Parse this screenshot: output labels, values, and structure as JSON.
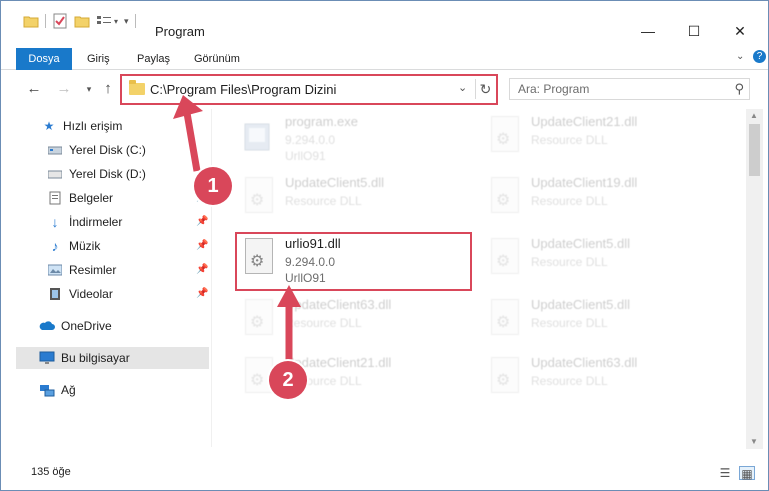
{
  "window": {
    "title": "Program"
  },
  "ribbon": {
    "tabs": [
      {
        "label": "Dosya"
      },
      {
        "label": "Giriş"
      },
      {
        "label": "Paylaş"
      },
      {
        "label": "Görünüm"
      }
    ]
  },
  "address": {
    "path": "C:\\Program Files\\Program Dizini"
  },
  "search": {
    "placeholder": "Ara: Program"
  },
  "sidebar": {
    "items": [
      {
        "label": "Hızlı erişim",
        "icon": "star-icon"
      },
      {
        "label": "Yerel Disk (C:)",
        "icon": "drive-icon"
      },
      {
        "label": "Yerel Disk (D:)",
        "icon": "drive-icon"
      },
      {
        "label": "Belgeler",
        "icon": "documents-icon"
      },
      {
        "label": "İndirmeler",
        "icon": "download-icon"
      },
      {
        "label": "Müzik",
        "icon": "music-icon"
      },
      {
        "label": "Resimler",
        "icon": "pictures-icon"
      },
      {
        "label": "Videolar",
        "icon": "videos-icon"
      },
      {
        "label": "OneDrive",
        "icon": "cloud-icon"
      },
      {
        "label": "Bu bilgisayar",
        "icon": "computer-icon"
      },
      {
        "label": "Ağ",
        "icon": "network-icon"
      }
    ]
  },
  "files": [
    {
      "name": "program.exe",
      "line2": "9.294.0.0",
      "line3": "UrllO91"
    },
    {
      "name": "UpdateClient21.dll",
      "line2": "Resource DLL",
      "line3": ""
    },
    {
      "name": "UpdateClient5.dll",
      "line2": "Resource DLL",
      "line3": ""
    },
    {
      "name": "UpdateClient19.dll",
      "line2": "Resource DLL",
      "line3": ""
    },
    {
      "name": "urlio91.dll",
      "line2": "9.294.0.0",
      "line3": "UrllO91"
    },
    {
      "name": "UpdateClient5.dll",
      "line2": "Resource DLL",
      "line3": ""
    },
    {
      "name": "UpdateClient63.dll",
      "line2": "Resource DLL",
      "line3": ""
    },
    {
      "name": "UpdateClient5.dll",
      "line2": "Resource DLL",
      "line3": ""
    },
    {
      "name": "UpdateClient21.dll",
      "line2": "Resource DLL",
      "line3": ""
    },
    {
      "name": "UpdateClient63.dll",
      "line2": "Resource DLL",
      "line3": ""
    }
  ],
  "status": {
    "count_text": "135 öğe"
  },
  "annotations": {
    "step1": "1",
    "step2": "2"
  },
  "colors": {
    "accent": "#1979ca",
    "highlight": "#d9475a"
  }
}
